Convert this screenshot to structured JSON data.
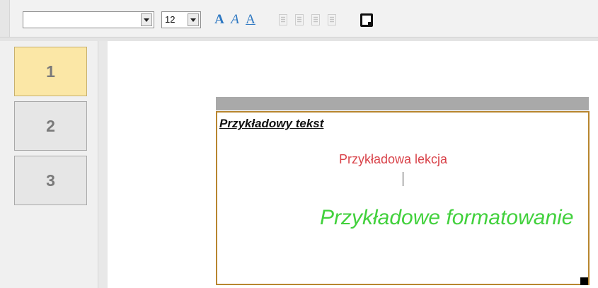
{
  "toolbar": {
    "font_family_value": "",
    "font_size_value": "12",
    "buttons": {
      "bold_glyph": "A",
      "italic_glyph": "A",
      "underline_glyph": "A"
    },
    "icons": [
      "chevron-down-icon",
      "bold-icon",
      "italic-icon",
      "underline-icon",
      "align-left-icon",
      "align-center-icon",
      "align-right-icon",
      "align-justify-icon",
      "frame-border-icon"
    ],
    "accent_color": "#2e78c2"
  },
  "sidebar": {
    "slides": [
      {
        "label": "1",
        "active": true
      },
      {
        "label": "2",
        "active": false
      },
      {
        "label": "3",
        "active": false
      }
    ],
    "active_color": "#fbe7a6"
  },
  "canvas": {
    "frame_title": "Przykładowy tekst",
    "lesson_text": "Przykładowa lekcja",
    "format_text": "Przykładowe formatowanie",
    "lesson_color": "#d9434a",
    "format_color": "#42d13d",
    "frame_border_color": "#b8862f"
  }
}
